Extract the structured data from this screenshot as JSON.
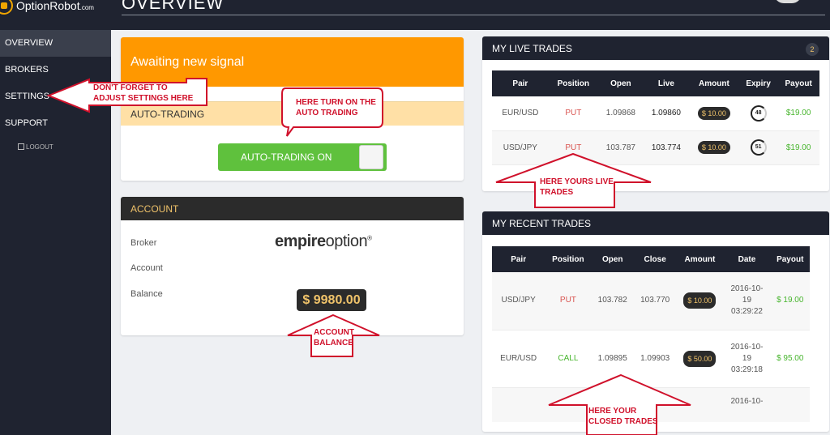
{
  "brand": {
    "name": "OptionRobot",
    "suffix": ".com"
  },
  "page_title": "OVERVIEW",
  "sidebar": {
    "items": [
      {
        "label": "OVERVIEW"
      },
      {
        "label": "BROKERS"
      },
      {
        "label": "SETTINGS"
      },
      {
        "label": "SUPPORT"
      }
    ],
    "logout": "LOGOUT"
  },
  "signal": {
    "status": "Awaiting new signal"
  },
  "auto_trading": {
    "header": "AUTO-TRADING",
    "toggle_label": "AUTO-TRADING ON"
  },
  "account": {
    "header": "ACCOUNT",
    "broker_label": "Broker",
    "account_label": "Account",
    "balance_label": "Balance",
    "broker_logo": {
      "part1": "empire",
      "part2": "option",
      "mark": "®"
    },
    "balance": "$ 9980.00"
  },
  "live_trades": {
    "title": "MY LIVE TRADES",
    "count": "2",
    "columns": [
      "Pair",
      "Position",
      "Open",
      "Live",
      "Amount",
      "Expiry",
      "Payout"
    ],
    "rows": [
      {
        "pair": "EUR/USD",
        "position": "PUT",
        "open": "1.09868",
        "live": "1.09860",
        "amount": "$ 10.00",
        "expiry": "48",
        "payout": "$19.00"
      },
      {
        "pair": "USD/JPY",
        "position": "PUT",
        "open": "103.787",
        "live": "103.774",
        "amount": "$ 10.00",
        "expiry": "51",
        "payout": "$19.00"
      }
    ]
  },
  "recent_trades": {
    "title": "MY RECENT TRADES",
    "columns": [
      "Pair",
      "Position",
      "Open",
      "Close",
      "Amount",
      "Date",
      "Payout"
    ],
    "rows": [
      {
        "pair": "USD/JPY",
        "position": "PUT",
        "open": "103.782",
        "close": "103.770",
        "amount": "$ 10.00",
        "date_l1": "2016-10-",
        "date_l2": "19",
        "date_l3": "03:29:22",
        "payout": "$ 19.00"
      },
      {
        "pair": "EUR/USD",
        "position": "CALL",
        "open": "1.09895",
        "close": "1.09903",
        "amount": "$ 50.00",
        "date_l1": "2016-10-",
        "date_l2": "19",
        "date_l3": "03:29:18",
        "payout": "$ 95.00"
      },
      {
        "pair": "",
        "position": "",
        "open": "",
        "close": "",
        "amount": "",
        "date_l1": "2016-10-",
        "date_l2": "",
        "date_l3": "",
        "payout": ""
      }
    ]
  },
  "annotations": {
    "settings": [
      "DON'T FORGET TO",
      "ADJUST SETTINGS HERE"
    ],
    "auto": [
      "HERE TURN ON THE",
      "AUTO TRADING"
    ],
    "balance": [
      "ACCOUNT",
      "BALANCE"
    ],
    "live": [
      "HERE YOURS LIVE",
      "TRADES"
    ],
    "closed": [
      "HERE YOUR",
      "CLOSED TRADES"
    ],
    "color": "#d0112b"
  },
  "colors": {
    "accent": "#ff9800",
    "sidebar": "#1f2330",
    "toggle_on": "#5fc13d",
    "gold": "#f0c36a"
  }
}
